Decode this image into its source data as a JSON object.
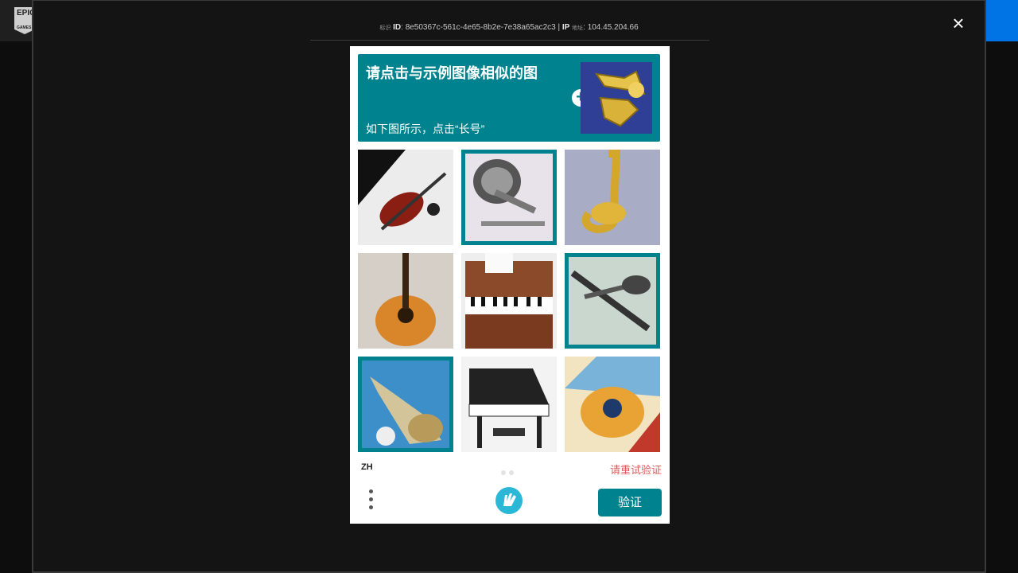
{
  "topbar": {
    "logo_text": "EPIC",
    "logo_sub": "GAMES"
  },
  "overlay": {
    "close_glyph": "×",
    "id_label_tiny": "标识",
    "id_label": "ID",
    "id_value": "8e50367c-561c-4e65-8b2e-7e38a65ac2c3",
    "ip_label": "IP",
    "ip_label_tiny": "地址",
    "ip_value": "104.45.204.66"
  },
  "captcha": {
    "prompt_title": "请点击与示例图像相似的图",
    "prompt_sub": "如下图所示，点击“长号”",
    "plus_glyph": "+",
    "tiles": [
      {
        "name": "violin",
        "selected": false
      },
      {
        "name": "trombone-bell",
        "selected": true
      },
      {
        "name": "saxophone",
        "selected": false
      },
      {
        "name": "acoustic-guitar",
        "selected": false
      },
      {
        "name": "upright-piano",
        "selected": false
      },
      {
        "name": "trombone-slide",
        "selected": true
      },
      {
        "name": "trombone-closeup",
        "selected": true
      },
      {
        "name": "grand-piano",
        "selected": false
      },
      {
        "name": "painted-guitar",
        "selected": false
      }
    ],
    "lang": "ZH",
    "error_text": "请重试验证",
    "verify_label": "验证"
  },
  "colors": {
    "accent": "#00838f",
    "error": "#e05a5a",
    "backdrop": "#141414"
  }
}
